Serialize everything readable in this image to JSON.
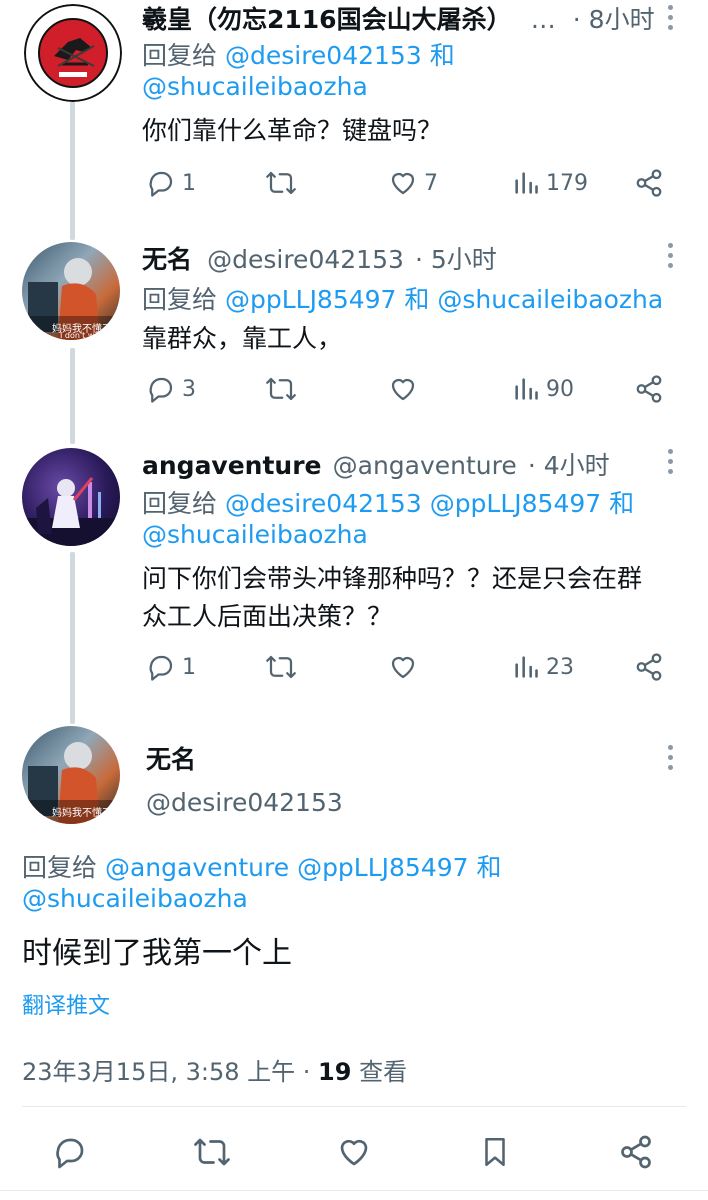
{
  "tweets": [
    {
      "name": "羲皇（勿忘2116国会山大屠杀）",
      "ellipsis": "…",
      "time": "· 8小时",
      "reply_prefix": "回复给",
      "reply_users": [
        "@desire042153",
        "@shucaileibaozha"
      ],
      "reply_joiner": "和",
      "text": "你们靠什么革命？键盘吗？",
      "replies": "1",
      "likes": "7",
      "views": "179",
      "avatar_text": [
        "NATIONAL",
        "RIFLE",
        "ASSOCIATION",
        "OF AMERICA",
        "INCORPORATED",
        "1871"
      ]
    },
    {
      "name": "无名",
      "handle": "@desire042153",
      "time": "· 5小时",
      "reply_prefix": "回复给",
      "reply_users": [
        "@ppLLJ85497",
        "@shucaileibaozha"
      ],
      "reply_joiner": "和",
      "text": "靠群众，靠工人，",
      "replies": "3",
      "likes": "",
      "views": "90",
      "avatar_caption": "妈妈我不懂了",
      "avatar_caption2": "I don't wan"
    },
    {
      "name": "angaventure",
      "handle": "@angaventure",
      "time": "· 4小时",
      "reply_prefix": "回复给",
      "reply_users": [
        "@desire042153",
        "@ppLLJ85497",
        "@shucaileibaozha"
      ],
      "reply_joiner": "和",
      "text_line1": "问下你们会带头冲锋那种吗？？还是只会在群",
      "text_line2": "众工人后面出决策？？",
      "replies": "1",
      "likes": "",
      "views": "23"
    }
  ],
  "main_tweet": {
    "name": "无名",
    "handle": "@desire042153",
    "reply_prefix": "回复给",
    "reply_users": [
      "@angaventure",
      "@ppLLJ85497",
      "@shucaileibaozha"
    ],
    "reply_joiner": "和",
    "text": "时候到了我第一个上",
    "translate": "翻译推文",
    "timestamp": "23年3月15日, 3:58 上午 ·",
    "views_count": "19",
    "views_label": "查看",
    "avatar_caption": "妈妈我不懂了"
  },
  "colors": {
    "link": "#1d9bf0",
    "secondary_text": "#536471",
    "primary_text": "#0f1419",
    "thread_line": "#cfd9de"
  },
  "icons": [
    "reply-icon",
    "retweet-icon",
    "like-icon",
    "views-icon",
    "share-icon",
    "bookmark-icon",
    "more-icon"
  ]
}
